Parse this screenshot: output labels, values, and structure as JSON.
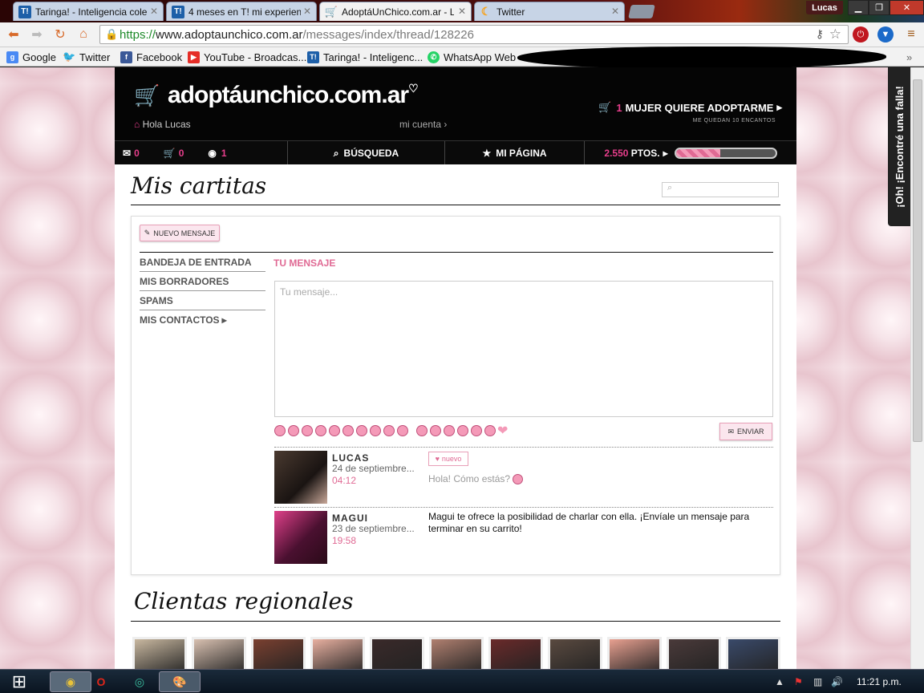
{
  "browser": {
    "tabs": [
      {
        "favicon": "T!",
        "title": "Taringa! - Inteligencia cole"
      },
      {
        "favicon": "T!",
        "title": "4 meses en T! mi experien"
      },
      {
        "favicon": "cart",
        "title": "AdoptáUnChico.com.ar - L"
      },
      {
        "favicon": "moon",
        "title": "Twitter"
      }
    ],
    "active_tab": 2,
    "user": "Lucas",
    "url_scheme": "https://",
    "url_host": "www.adoptaunchico.com.ar",
    "url_path": "/messages/index/thread/128226",
    "bookmarks": [
      {
        "icon": "google-icon",
        "label": "Google"
      },
      {
        "icon": "twitter-icon",
        "label": "Twitter"
      },
      {
        "icon": "facebook-icon",
        "label": "Facebook"
      },
      {
        "icon": "youtube-icon",
        "label": "YouTube - Broadcas..."
      },
      {
        "icon": "taringa-icon",
        "label": "Taringa! - Inteligenc..."
      },
      {
        "icon": "whatsapp-icon",
        "label": "WhatsApp Web"
      }
    ],
    "feedback_tab": "¡Oh! ¡Encontré una falla!"
  },
  "site": {
    "logo": "adoptáunchico.com.ar",
    "greeting": "Hola Lucas",
    "account_link": "mi cuenta",
    "adopt_count": "1",
    "adopt_label": "MUJER QUIERE ADOPTARME",
    "encantos": "ME QUEDAN 10 ENCANTOS",
    "nav": {
      "messages_count": "0",
      "cart_count": "0",
      "visits_count": "1",
      "search": "BÚSQUEDA",
      "my_page": "MI PÁGINA",
      "points": "2.550",
      "points_label": "PTOS.",
      "points_progress": 0.45
    }
  },
  "messages": {
    "title": "Mis cartitas",
    "new_button": "NUEVO MENSAJE",
    "sidebar": [
      "BANDEJA DE ENTRADA",
      "MIS BORRADORES",
      "SPAMS",
      "MIS CONTACTOS"
    ],
    "compose_heading": "TU MENSAJE",
    "compose_placeholder": "Tu mensaje...",
    "send_button": "ENVIAR",
    "new_badge": "nuevo",
    "thread": [
      {
        "name": "LUCAS",
        "date": "24 de septiembre...",
        "time": "04:12",
        "text": "Hola! Cómo estás?"
      },
      {
        "name": "MAGUI",
        "date": "23 de septiembre...",
        "time": "19:58",
        "text": "Magui te ofrece la posibilidad de charlar con ella. ¡Envíale un mensaje para terminar en su carrito!"
      }
    ]
  },
  "regional": {
    "title": "Clientas regionales",
    "count": 11
  },
  "taskbar": {
    "clock": "11:21 p.m."
  },
  "colors": {
    "accent_pink": "#e83e8c",
    "header_black": "#050505"
  }
}
